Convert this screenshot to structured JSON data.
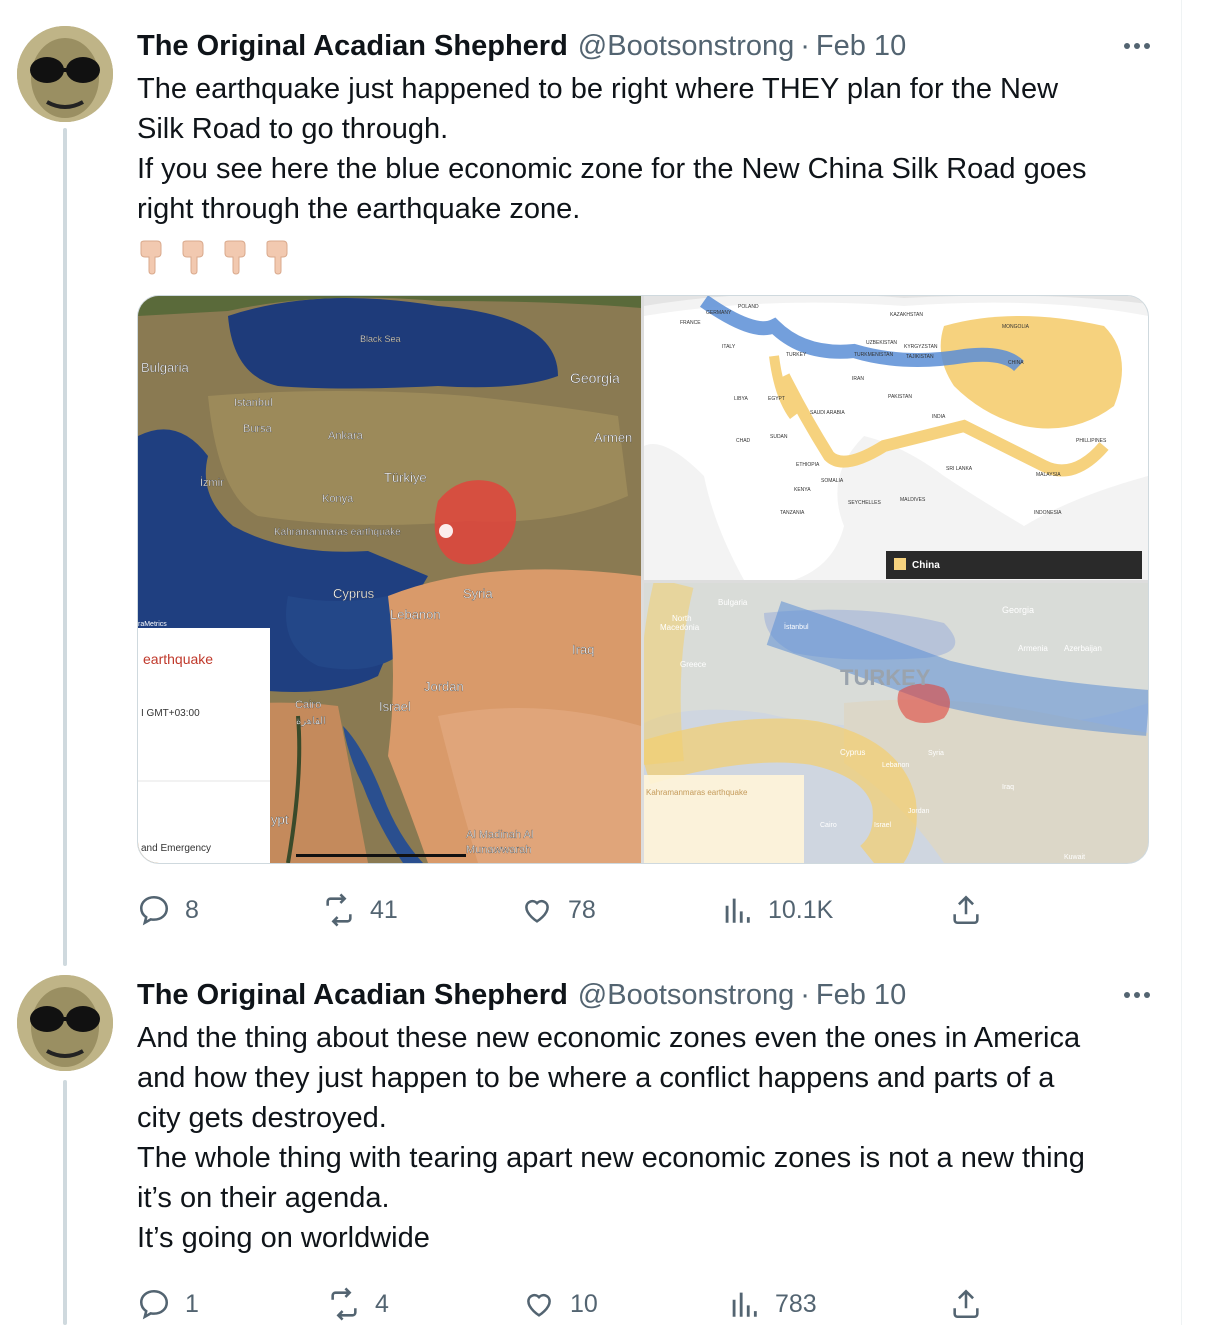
{
  "tweets": [
    {
      "author_name": "The Original Acadian Shepherd",
      "handle": "@Bootsonstrong",
      "separator": "·",
      "date": "Feb 10",
      "text_lines": [
        "The earthquake just happened to be right where THEY plan for the New",
        "Silk Road to go through.",
        "If you see here the blue economic zone for the New China Silk Road goes",
        "right through the earthquake zone."
      ],
      "emojis": [
        "point-down-icon",
        "point-down-icon",
        "point-down-icon",
        "point-down-icon"
      ],
      "stats": {
        "replies": "8",
        "retweets": "41",
        "likes": "78",
        "views": "10.1K"
      }
    },
    {
      "author_name": "The Original Acadian Shepherd",
      "handle": "@Bootsonstrong",
      "separator": "·",
      "date": "Feb 10",
      "text_lines": [
        "And the thing about these new economic zones even the ones in America",
        "and how they just happen to be where a conflict happens and parts of a",
        "city gets destroyed.",
        "The whole thing with tearing apart new economic zones is not a new thing",
        "it’s on their agenda.",
        "It’s going on worldwide"
      ],
      "stats": {
        "replies": "1",
        "retweets": "4",
        "likes": "10",
        "views": "783"
      }
    }
  ],
  "media": {
    "left_map_labels": {
      "black_sea": "Black Sea",
      "bulgaria": "Bulgaria",
      "georgia": "Georgia",
      "istanbul": "Istanbul",
      "bursa": "Bursa",
      "ankara": "Ankara",
      "armenia": "Armen",
      "izmir": "İzmir",
      "turkiye": "Türkiye",
      "konya": "Konya",
      "quake": "Kahramanmaras earthquake",
      "cyprus": "Cyprus",
      "syria": "Syria",
      "lebanon": "Lebanon",
      "iraq": "Iraq",
      "jordan": "Jordan",
      "cairo": "Cairo",
      "cairo_ar": "القاهرة",
      "israel": "Israel",
      "egypt": "ypt",
      "madinah1": "Al Madinah Al",
      "madinah2": "Munawwarah",
      "metrics": "raMetrics",
      "card_title": "earthquake",
      "card_time": "I GMT+03:00",
      "card_footer": "and Emergency"
    },
    "tr_map_labels": {
      "france": "FRANCE",
      "germany": "GERMANY",
      "poland": "POLAND",
      "kazakhstan": "KAZAKHSTAN",
      "mongolia": "MONGOLIA",
      "italy": "ITALY",
      "turkey": "TURKEY",
      "uzbekistan": "UZBEKISTAN",
      "kyrgyzstan": "KYRGYZSTAN",
      "turkmenistan": "TURKMENISTAN",
      "tajikistan": "TAJIKISTAN",
      "china": "CHINA",
      "iran": "IRAN",
      "libya": "LIBYA",
      "egypt": "EGYPT",
      "pakistan": "PAKISTAN",
      "saudi": "SAUDI ARABIA",
      "india": "INDIA",
      "chad": "CHAD",
      "sudan": "SUDAN",
      "ethiopia": "ETHIOPIA",
      "somalia": "SOMALIA",
      "kenya": "KENYA",
      "srilanka": "SRI LANKA",
      "malaysia": "MALAYSIA",
      "philippines": "PHILLIPINES",
      "tanzania": "TANZANIA",
      "seychelles": "SEYCHELLES",
      "maldives": "MALDIVES",
      "indonesia": "INDONESIA",
      "legend": "China"
    },
    "br_map_labels": {
      "bulgaria": "Bulgaria",
      "georgia": "Georgia",
      "macedonia1": "North",
      "macedonia2": "Macedonia",
      "istanbul": "İstanbul",
      "greece": "Greece",
      "armenia": "Armenia",
      "azerbaijan": "Azerbaijan",
      "turkey": "TURKEY",
      "cyprus": "Cyprus",
      "syria": "Syria",
      "lebanon": "Lebanon",
      "iraq": "Iraq",
      "jordan": "Jordan",
      "israel": "Israel",
      "cairo": "Cairo",
      "kuwait": "Kuwait",
      "quake": "Kahramanmaras earthquake"
    }
  },
  "colors": {
    "accent_text": "#0f1419",
    "muted": "#536471",
    "thread_line": "#cfd9de",
    "silk_road_blue": "#5b8ed6",
    "china_yellow": "#f6d27e",
    "quake_red": "#e0443c"
  }
}
